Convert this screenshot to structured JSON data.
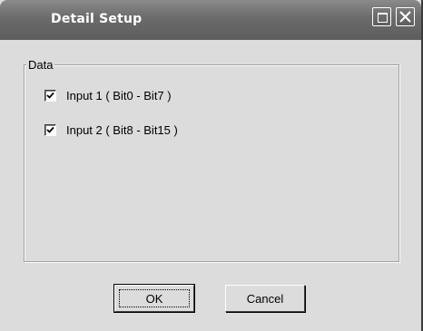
{
  "window": {
    "title": "Detail Setup",
    "maximize_icon": "maximize-icon",
    "close_icon": "close-icon"
  },
  "group": {
    "label": "Data",
    "items": [
      {
        "label": "Input 1 ( Bit0 - Bit7 )",
        "checked": true
      },
      {
        "label": "Input 2 ( Bit8 - Bit15 )",
        "checked": true
      }
    ]
  },
  "buttons": {
    "ok": "OK",
    "cancel": "Cancel"
  }
}
